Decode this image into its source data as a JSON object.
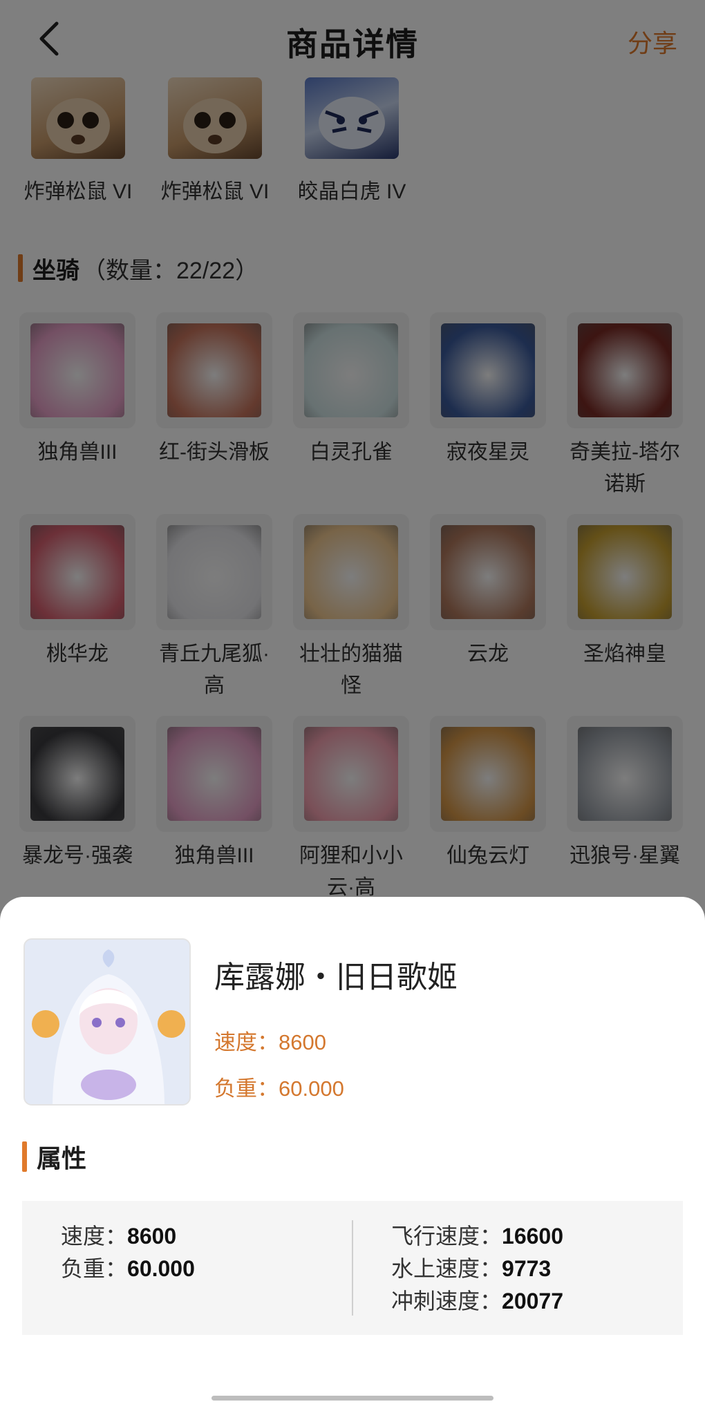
{
  "header": {
    "title": "商品详情",
    "share_label": "分享"
  },
  "pets": [
    {
      "name": "炸弹松鼠 VI",
      "rank": "VI"
    },
    {
      "name": "炸弹松鼠 VI",
      "rank": "VI"
    },
    {
      "name": "皎晶白虎 IV",
      "rank": "IV"
    }
  ],
  "mounts_section": {
    "title": "坐骑",
    "count": "（数量：22/22）"
  },
  "mounts": [
    {
      "name": "独角兽III",
      "color": "#e8a0c8"
    },
    {
      "name": "红-街头滑板",
      "color": "#c8745c"
    },
    {
      "name": "白灵孔雀",
      "color": "#cfe3e4"
    },
    {
      "name": "寂夜星灵",
      "color": "#3a5a9c"
    },
    {
      "name": "奇美拉-塔尔诺斯",
      "color": "#7a2a24"
    },
    {
      "name": "桃华龙",
      "color": "#d86070"
    },
    {
      "name": "青丘九尾狐·高",
      "color": "#e6e6ea"
    },
    {
      "name": "壮壮的猫猫怪",
      "color": "#f0c890"
    },
    {
      "name": "云龙",
      "color": "#b0785c"
    },
    {
      "name": "圣焰神皇",
      "color": "#c8a030"
    },
    {
      "name": "暴龙号·强袭",
      "color": "#3a3a3e"
    },
    {
      "name": "独角兽III",
      "color": "#e8a0c8"
    },
    {
      "name": "阿狸和小小云·高",
      "color": "#f4a0b0"
    },
    {
      "name": "仙兔云灯",
      "color": "#d89848"
    },
    {
      "name": "迅狼号·星翼",
      "color": "#9aa0a8"
    }
  ],
  "detail": {
    "name": "库露娜・旧日歌姬",
    "speed_line": "速度：8600",
    "load_line": "负重：60.000"
  },
  "attributes": {
    "title": "属性",
    "left": [
      {
        "label": "速度：",
        "value": "8600"
      },
      {
        "label": "负重：",
        "value": "60.000"
      }
    ],
    "right": [
      {
        "label": "飞行速度：",
        "value": "16600"
      },
      {
        "label": "水上速度：",
        "value": "9773"
      },
      {
        "label": "冲刺速度：",
        "value": "20077"
      }
    ]
  }
}
